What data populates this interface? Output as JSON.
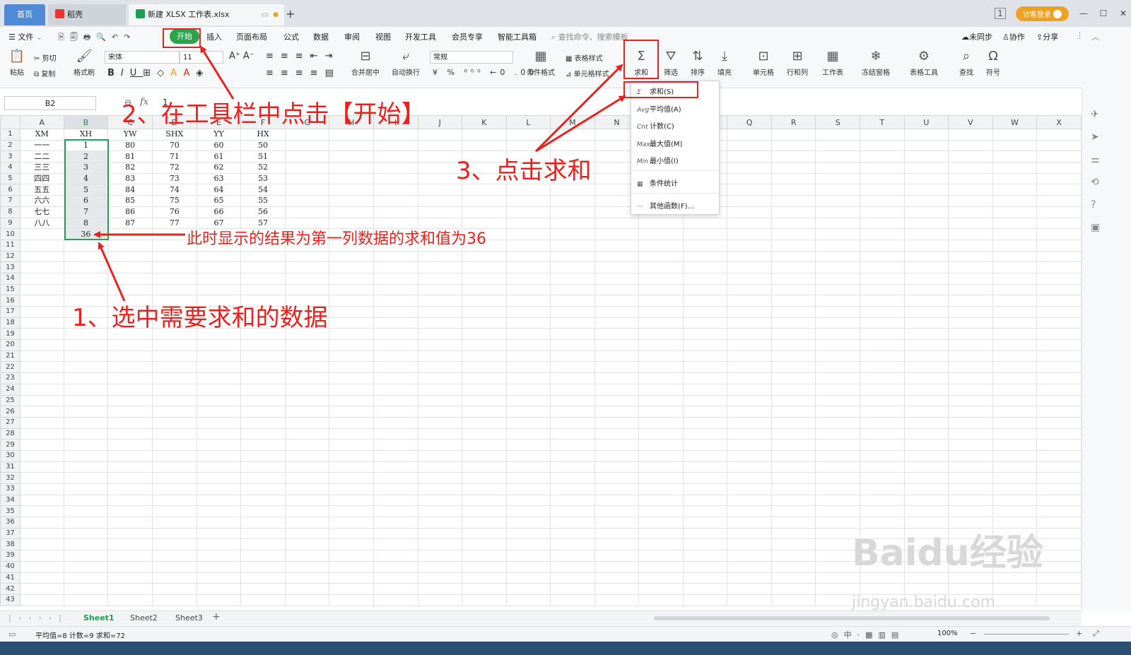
{
  "titlebar": {
    "tabs": [
      {
        "label": "首页"
      },
      {
        "label": "稻壳"
      },
      {
        "label": "新建 XLSX 工作表.xlsx"
      }
    ],
    "new_tab": "+",
    "login": "访客登录"
  },
  "menubar": {
    "file": "文件",
    "items": [
      "开始",
      "插入",
      "页面布局",
      "公式",
      "数据",
      "审阅",
      "视图",
      "开发工具",
      "会员专享",
      "智能工具箱"
    ],
    "search_placeholder": "查找命令、搜索模板",
    "right": [
      "未同步",
      "协作",
      "分享"
    ]
  },
  "ribbon": {
    "paste": "粘贴",
    "cut": "剪切",
    "copy": "复制",
    "format_painter": "格式刷",
    "font_name": "宋体",
    "font_size": "11",
    "merge_center": "合并居中",
    "wrap_text": "自动换行",
    "number_format": "常规",
    "conditional_format": "条件格式",
    "table_style": "表格样式",
    "cell_style": "单元格样式",
    "sum": "求和",
    "filter": "筛选",
    "sort": "排序",
    "fill": "填充",
    "cell": "单元格",
    "row_col": "行和列",
    "worksheet": "工作表",
    "freeze": "冻结窗格",
    "table_tools": "表格工具",
    "find": "查找",
    "symbol": "符号"
  },
  "formula_bar": {
    "name_box": "B2",
    "fx": "fx",
    "content": "1"
  },
  "sheet": {
    "columns": [
      "A",
      "B",
      "C",
      "D",
      "E",
      "F",
      "G",
      "H",
      "I",
      "J",
      "K",
      "L",
      "M",
      "N",
      "O",
      "P",
      "Q",
      "R",
      "S",
      "T",
      "U",
      "V",
      "W",
      "X"
    ],
    "row_count": 43,
    "header": [
      "XM",
      "XH",
      "YW",
      "SHX",
      "YY",
      "HX"
    ],
    "rows": [
      [
        "一一",
        "1",
        "80",
        "70",
        "60",
        "50"
      ],
      [
        "二二",
        "2",
        "81",
        "71",
        "61",
        "51"
      ],
      [
        "三三",
        "3",
        "82",
        "72",
        "62",
        "52"
      ],
      [
        "四四",
        "4",
        "83",
        "73",
        "63",
        "53"
      ],
      [
        "五五",
        "5",
        "84",
        "74",
        "64",
        "54"
      ],
      [
        "六六",
        "6",
        "85",
        "75",
        "65",
        "55"
      ],
      [
        "七七",
        "7",
        "86",
        "76",
        "66",
        "56"
      ],
      [
        "八八",
        "8",
        "87",
        "77",
        "67",
        "57"
      ]
    ],
    "sum_value": "36"
  },
  "sum_dropdown": {
    "items": [
      {
        "icon": "Σ",
        "label": "求和(S)"
      },
      {
        "icon": "Avg",
        "label": "平均值(A)"
      },
      {
        "icon": "Cnt",
        "label": "计数(C)"
      },
      {
        "icon": "Max",
        "label": "最大值(M)"
      },
      {
        "icon": "Min",
        "label": "最小值(I)"
      },
      {
        "icon": "▦",
        "label": "条件统计"
      },
      {
        "icon": "···",
        "label": "其他函数(F)..."
      }
    ]
  },
  "annotations": {
    "step1": "1、选中需要求和的数据",
    "step2": "2、在工具栏中点击【开始】",
    "step3": "3、点击求和",
    "note": "此时显示的结果为第一列数据的求和值为36"
  },
  "sheet_tabs": [
    "Sheet1",
    "Sheet2",
    "Sheet3"
  ],
  "status_bar": {
    "stats": "平均值=8  计数=9  求和=72",
    "zoom": "100%"
  },
  "watermark": {
    "main": "Baidu经验",
    "sub": "jingyan.baidu.com"
  },
  "colors": {
    "accent": "#2aa34a",
    "annotation": "#e8231f",
    "selection": "#1fa356"
  }
}
